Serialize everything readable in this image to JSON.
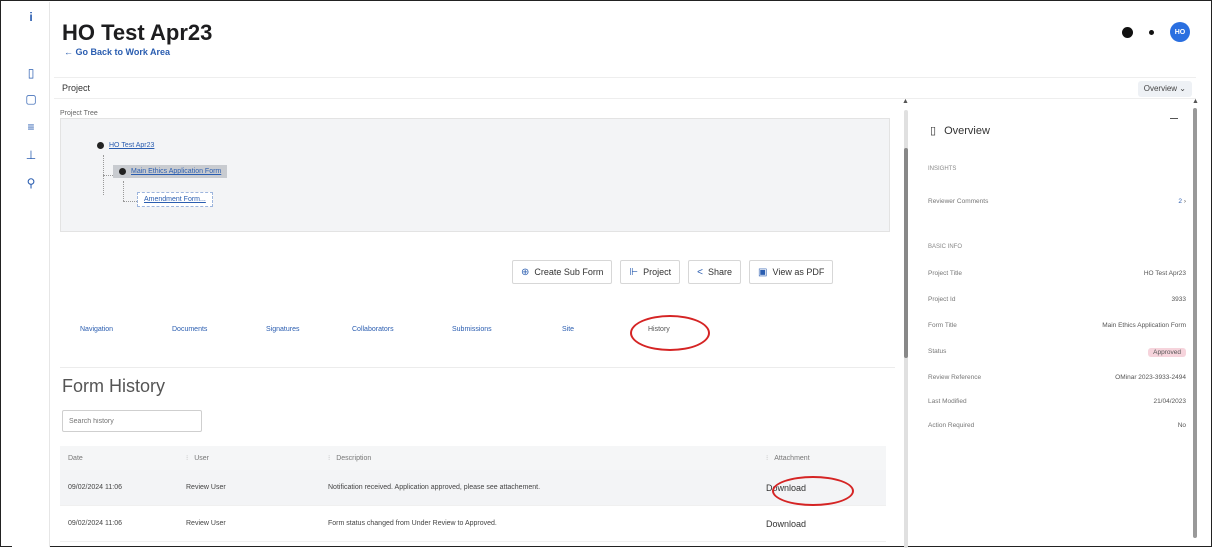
{
  "header": {
    "title": "HO Test Apr23",
    "back_link": "← Go Back to Work Area",
    "avatar": "HO"
  },
  "project_bar": {
    "tab": "Project",
    "overview_dropdown": "Overview ⌄"
  },
  "tree": {
    "label": "Project Tree",
    "nodes": [
      "HO Test Apr23",
      "Main Ethics Application Form",
      "Amendment Form..."
    ]
  },
  "actions": {
    "create_sub_form": "Create Sub Form",
    "project": "Project",
    "share": "Share",
    "view_pdf": "View as PDF"
  },
  "tabs": [
    "Navigation",
    "Documents",
    "Signatures",
    "Collaborators",
    "Submissions",
    "Site",
    "History"
  ],
  "history": {
    "title": "Form History",
    "search_placeholder": "Search history",
    "columns": [
      "Date",
      "User",
      "Description",
      "Attachment"
    ],
    "rows": [
      {
        "date": "09/02/2024 11:06",
        "user": "Review User",
        "description": "Notification received. Application approved, please see attachement.",
        "attachment": "Download"
      },
      {
        "date": "09/02/2024 11:06",
        "user": "Review User",
        "description": "Form status changed from Under Review to Approved.",
        "attachment": "Download"
      }
    ]
  },
  "overview": {
    "title": "Overview",
    "insights_label": "INSIGHTS",
    "reviewer_comments_label": "Reviewer Comments",
    "reviewer_comments_count": "2",
    "basic_info_label": "BASIC INFO",
    "fields": [
      {
        "label": "Project Title",
        "value": "HO Test Apr23"
      },
      {
        "label": "Project Id",
        "value": "3933"
      },
      {
        "label": "Form Title",
        "value": "Main Ethics Application Form"
      },
      {
        "label": "Status",
        "value": "Approved"
      },
      {
        "label": "Review Reference",
        "value": "OMinar 2023-3933-2494"
      },
      {
        "label": "Last Modified",
        "value": "21/04/2023"
      },
      {
        "label": "Action Required",
        "value": "No"
      }
    ]
  },
  "colors": {
    "accent": "#2a5db0",
    "highlight_oval": "#d52424",
    "badge_bg": "#f6d4dc",
    "avatar": "#2a6fe0"
  }
}
